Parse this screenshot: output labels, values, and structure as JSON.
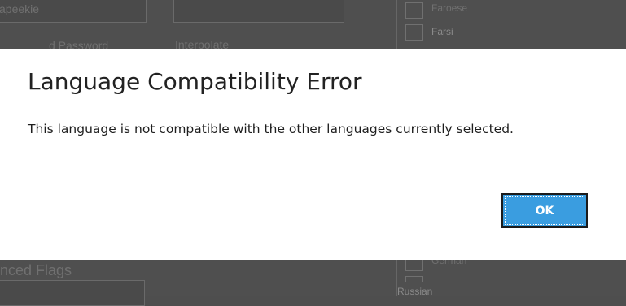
{
  "background": {
    "top_left_field_value": "apeekie",
    "interpolate_label": "Interpolate",
    "password_label": "d Password",
    "languages_top": [
      {
        "label": "Faroese"
      },
      {
        "label": "Farsi"
      }
    ],
    "languages_bottom": [
      {
        "label": "German"
      }
    ],
    "selected_language": "Russian",
    "advanced_flags_label": "nced Flags"
  },
  "dialog": {
    "title": "Language Compatibility Error",
    "message": "This language is not compatible with the other languages currently selected.",
    "ok_label": "OK",
    "ok_color": "#3a9de0"
  }
}
